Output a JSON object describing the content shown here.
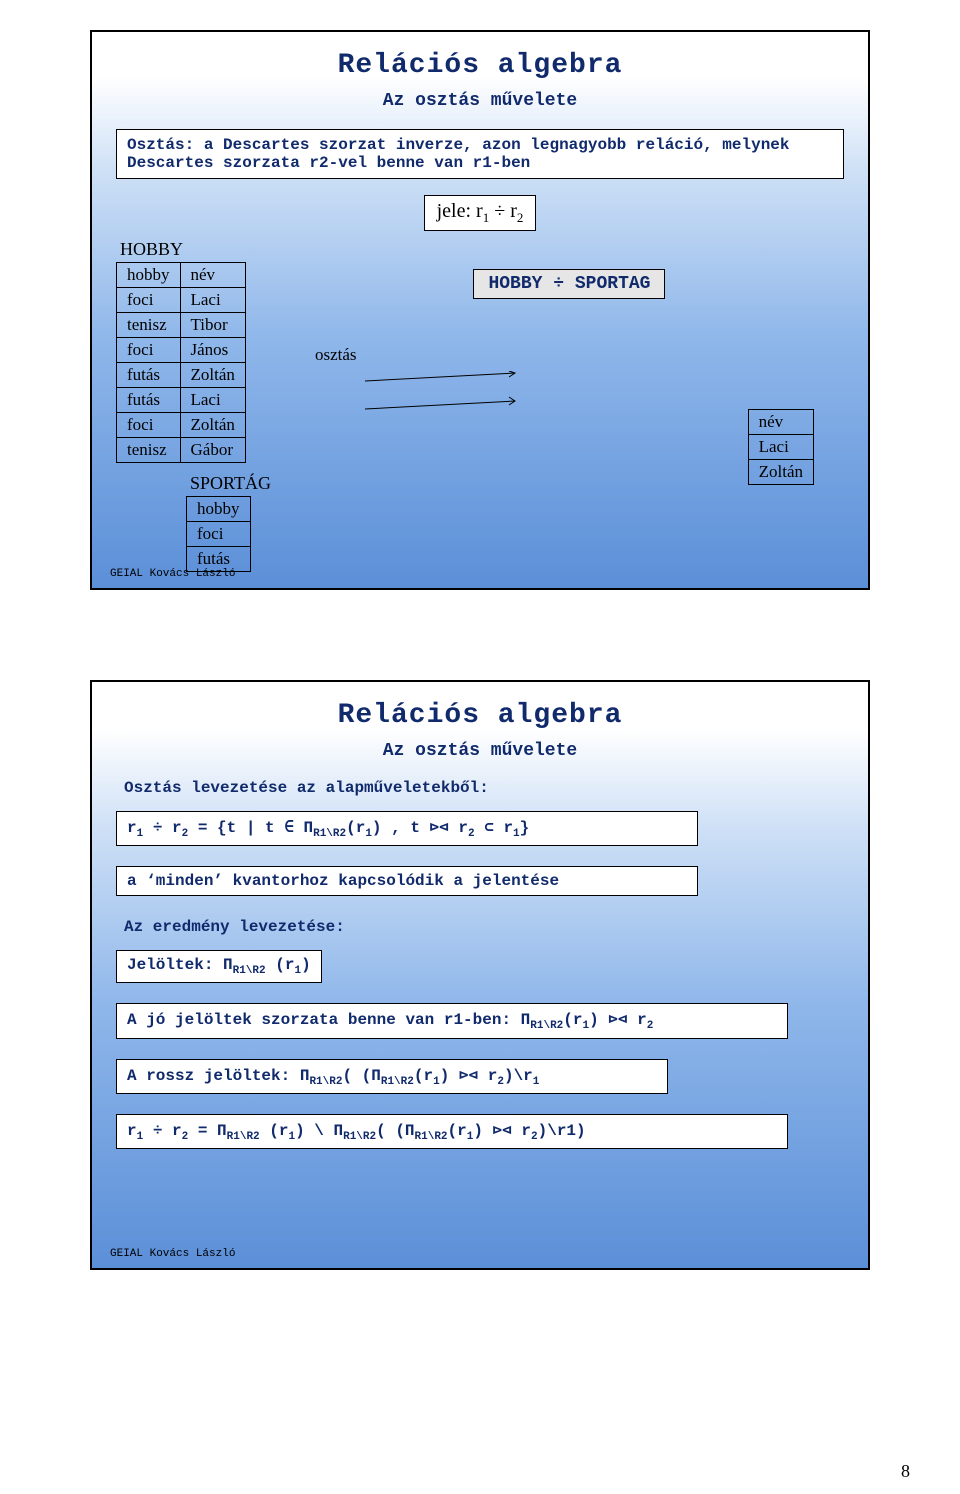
{
  "slide1": {
    "title": "Relációs algebra",
    "subtitle": "Az osztás művelete",
    "definition": "Osztás: a Descartes szorzat inverze, azon legnagyobb reláció, melynek Descartes szorzata r2-vel benne van r1-ben",
    "notation_prefix": "jele:  r",
    "notation_mid": " ÷ r",
    "hobby_name": "HOBBY",
    "hobby_headers": [
      "hobby",
      "név"
    ],
    "hobby_rows": [
      [
        "foci",
        "Laci"
      ],
      [
        "tenisz",
        "Tibor"
      ],
      [
        "foci",
        "János"
      ],
      [
        "futás",
        "Zoltán"
      ],
      [
        "futás",
        "Laci"
      ],
      [
        "foci",
        "Zoltán"
      ],
      [
        "tenisz",
        "Gábor"
      ]
    ],
    "sportag_name": "SPORTÁG",
    "sportag_header": "hobby",
    "sportag_rows": [
      "foci",
      "futás"
    ],
    "opbox": "HOBBY ÷ SPORTAG",
    "osztas_label": "osztás",
    "result_header": "név",
    "result_rows": [
      "Laci",
      "Zoltán"
    ],
    "footer": "GEIAL Kovács László"
  },
  "slide2": {
    "title": "Relációs algebra",
    "subtitle": "Az osztás művelete",
    "line1": "Osztás levezetése az alapműveletekből:",
    "formula1_a": "r",
    "formula1_b": " ÷ r",
    "formula1_c": "  = {t   | t ∈ Π",
    "formula1_sub1": "R1\\R2",
    "formula1_d": "(r",
    "formula1_e": ") ,   t ⊳⊲ r",
    "formula1_f": "  ⊂ r",
    "formula1_g": "}",
    "box2": "a ‘minden’ kvantorhoz kapcsolódik a jelentése",
    "line2": "Az eredmény levezetése:",
    "box3_a": "Jelöltek: Π",
    "box3_sub": "R1\\R2",
    "box3_b": " (r",
    "box3_c": ")",
    "box4_a": "A jó jelöltek szorzata benne van r1-ben: Π",
    "box4_sub": "R1\\R2",
    "box4_b": "(r",
    "box4_c": ") ⊳⊲ r",
    "box5_a": "A rossz jelöltek: Π",
    "box5_sub1": "R1\\R2",
    "box5_b": "( (Π",
    "box5_sub2": "R1\\R2",
    "box5_c": "(r",
    "box5_d": ") ⊳⊲ r",
    "box5_e": ")\\r",
    "box6_a": "r",
    "box6_b": " ÷ r",
    "box6_c": "  = Π",
    "box6_sub1": "R1\\R2",
    "box6_d": " (r",
    "box6_e": ") \\ Π",
    "box6_sub2": "R1\\R2",
    "box6_f": "( (Π",
    "box6_sub3": "R1\\R2",
    "box6_g": "(r",
    "box6_h": ") ⊳⊲ r",
    "box6_i": ")\\r1)",
    "footer": "GEIAL Kovács László"
  },
  "pagenum": "8"
}
